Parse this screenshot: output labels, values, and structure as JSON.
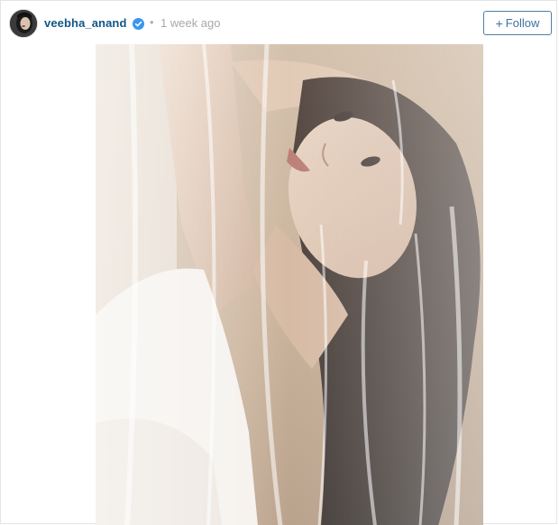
{
  "post": {
    "username": "veebha_anand",
    "separator": "•",
    "timestamp": "1 week ago",
    "follow_plus": "+",
    "follow_label": "Follow",
    "verified": true
  },
  "colors": {
    "username": "#125688",
    "verified_badge": "#3897f0",
    "follow_border": "#4e7ea7",
    "follow_text": "#3f729b"
  },
  "icons": {
    "verified": "verified-badge-icon",
    "avatar": "profile-avatar"
  }
}
